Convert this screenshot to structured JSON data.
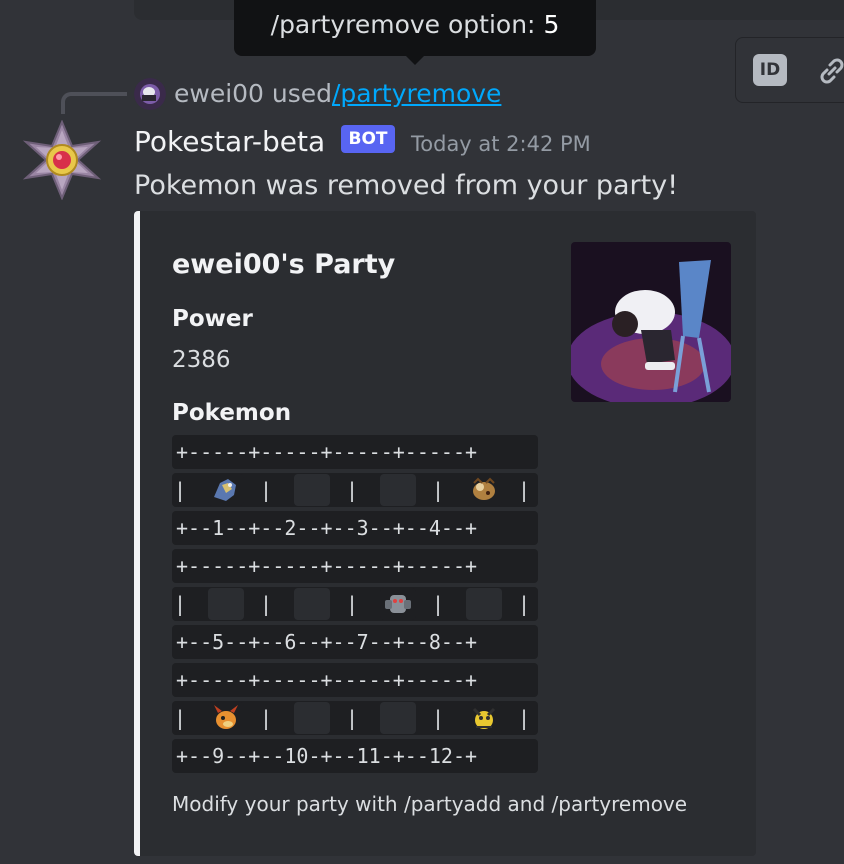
{
  "tooltip": {
    "label": "/partyremove option: ",
    "value": "5"
  },
  "toolbar": {
    "id_icon_label": "ID"
  },
  "reference": {
    "username": "ewei00 used",
    "command": "/partyremove"
  },
  "message": {
    "author": "Pokestar-beta",
    "bot_tag": "BOT",
    "timestamp": "Today at 2:42 PM",
    "content": "Pokemon was removed from your party!"
  },
  "embed": {
    "accent_color": "#f2f3f5",
    "title": "ewei00's Party",
    "fields": [
      {
        "name": "Power",
        "value": "2386"
      },
      {
        "name": "Pokemon",
        "value": ""
      }
    ],
    "footer": "Modify your party with /partyadd and /partyremove",
    "grid": {
      "border": "+-----+-----+-----+-----+",
      "rows": [
        {
          "label_line": "+--1--+--2--+--3--+--4--+",
          "slots": [
            {
              "filled": true,
              "icon": "blue-pokemon-sprite"
            },
            {
              "filled": false,
              "icon": ""
            },
            {
              "filled": false,
              "icon": ""
            },
            {
              "filled": true,
              "icon": "brown-pokemon-sprite"
            }
          ]
        },
        {
          "label_line": "+--5--+--6--+--7--+--8--+",
          "slots": [
            {
              "filled": false,
              "icon": ""
            },
            {
              "filled": false,
              "icon": ""
            },
            {
              "filled": true,
              "icon": "gray-pokemon-sprite"
            },
            {
              "filled": false,
              "icon": ""
            }
          ]
        },
        {
          "label_line": "+--9--+--10-+--11-+--12-+",
          "slots": [
            {
              "filled": true,
              "icon": "orange-pokemon-sprite"
            },
            {
              "filled": false,
              "icon": ""
            },
            {
              "filled": false,
              "icon": ""
            },
            {
              "filled": true,
              "icon": "yellow-pokemon-sprite"
            }
          ]
        }
      ]
    }
  },
  "colors": {
    "background": "#313338",
    "embed_background": "#2b2d31",
    "link": "#00a8fc",
    "bot_tag": "#5865f2",
    "timestamp": "#949ba4"
  }
}
